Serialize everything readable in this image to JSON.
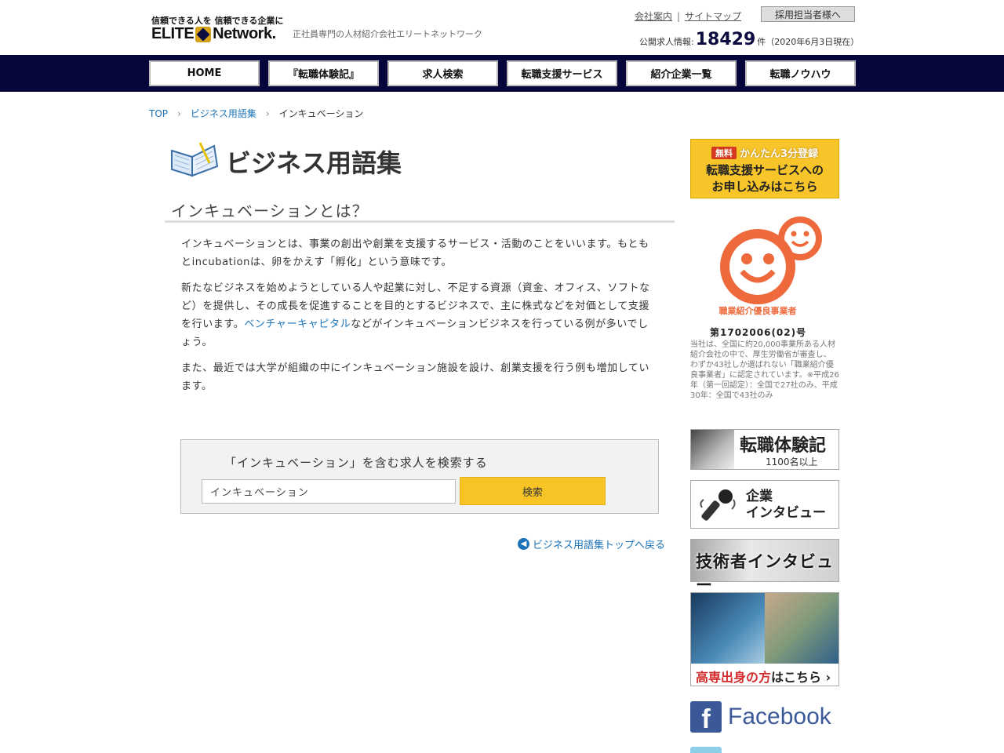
{
  "header": {
    "logo_tagline": "信頼できる人を 信頼できる企業に",
    "logo_text_left": "ELITE",
    "logo_text_right": "Network.",
    "tagline": "正社員専門の人材紹介会社エリートネットワーク",
    "links": [
      "会社案内",
      "サイトマップ"
    ],
    "link_separator": "|",
    "recruiter_button": "採用担当者様へ",
    "job_count_label": "公開求人情報:",
    "job_count_value": "18429",
    "job_count_unit": "件",
    "job_count_date": "（2020年6月3日現在）"
  },
  "nav": {
    "items": [
      "HOME",
      "『転職体験記』",
      "求人検索",
      "転職支援サービス",
      "紹介企業一覧",
      "転職ノウハウ"
    ]
  },
  "breadcrumb": {
    "items": [
      "TOP",
      "ビジネス用語集"
    ],
    "current": "インキュベーション",
    "separator": "›"
  },
  "main": {
    "page_title": "ビジネス用語集",
    "section_heading": "インキュベーションとは？",
    "paragraphs": {
      "p1": "インキュベーションとは、事業の創出や創業を支援するサービス・活動のことをいいます。もともとincubationは、卵をかえす「孵化」という意味です。",
      "p2_before": "新たなビジネスを始めようとしている人や起業に対し、不足する資源（資金、オフィス、ソフトなど）を提供し、その成長を促進することを目的とするビジネスで、主に株式などを対価として支援を行います。",
      "p2_link": "ベンチャーキャピタル",
      "p2_after": "などがインキュベーションビジネスを行っている例が多いでしょう。",
      "p3": "また、最近では大学が組織の中にインキュベーション施設を設け、創業支援を行う例も増加しています。"
    },
    "search": {
      "label": "「インキュベーション」を含む求人を検索する",
      "input_value": "インキュベーション",
      "button": "検索"
    },
    "back_link": "ビジネス用語集トップへ戻る"
  },
  "sidebar": {
    "register_banner": {
      "free": "無料",
      "quick": "かんたん3分登録",
      "line1": "転職支援サービスへの",
      "line2": "お申し込みはこちら"
    },
    "award": {
      "arc_text": "職業紹介優良事業者",
      "number": "第1702006(02)号",
      "description": "当社は、全国に約20,000事業所ある人材紹介会社の中で、厚生労働省が審査し、 わずか43社しか選ばれない「職業紹介優良事業者」に認定されています。※平成26年（第一回認定）：全国で27社のみ、平成30年：全国で43社のみ"
    },
    "experience_card": {
      "title": "転職体験記",
      "sub": "1100名以上"
    },
    "interview_card": {
      "line1": "企業",
      "line2": "インタビュー"
    },
    "engineer_card": {
      "title": "技術者インタビュー"
    },
    "kosen_card": {
      "red": "高専出身の方",
      "rest": "はこちら",
      "chevron": "›"
    },
    "facebook": {
      "label": "Facebook",
      "letter": "f"
    }
  },
  "colors": {
    "nav_bg": "#06063a",
    "link": "#1a73b8",
    "search_button": "#f8c325",
    "award_orange": "#ee6a3c",
    "facebook": "#3b5998"
  }
}
